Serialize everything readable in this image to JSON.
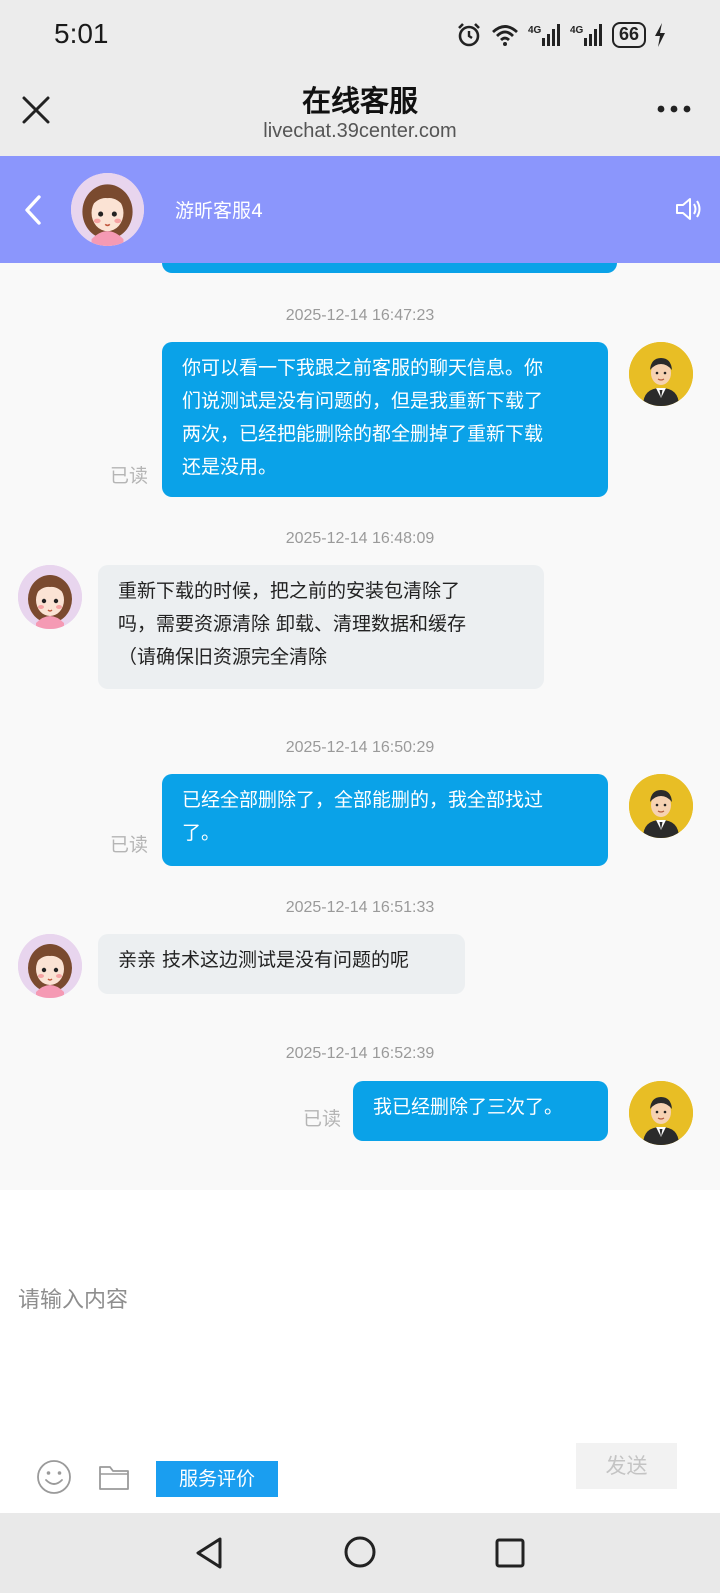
{
  "status_bar": {
    "time": "5:01",
    "battery": "66",
    "icons": [
      "alarm-icon",
      "wifi-icon",
      "signal-4g-icon",
      "signal-4g-icon",
      "charging-icon"
    ]
  },
  "browser": {
    "title": "在线客服",
    "url": "livechat.39center.com"
  },
  "chat_header": {
    "agent_name": "游昕客服4",
    "colors": {
      "header_bg": "#8b96fc"
    }
  },
  "messages": {
    "read_label": "已读",
    "items": [
      {
        "timestamp": "2025-12-14 16:47:23",
        "side": "sent",
        "lines": [
          "你可以看一下我跟之前客服的聊天信息。你",
          "们说测试是没有问题的，但是我重新下载了",
          "两次，已经把能删除的都全删掉了重新下载",
          "还是没用。"
        ],
        "read": true
      },
      {
        "timestamp": "2025-12-14 16:48:09",
        "side": "received",
        "lines": [
          "重新下载的时候，把之前的安装包清除了",
          "吗，需要资源清除 卸载、清理数据和缓存",
          "（请确保旧资源完全清除"
        ]
      },
      {
        "timestamp": "2025-12-14 16:50:29",
        "side": "sent",
        "lines": [
          "已经全部删除了，全部能删的，我全部找过",
          "了。"
        ],
        "read": true
      },
      {
        "timestamp": "2025-12-14 16:51:33",
        "side": "received",
        "lines": [
          "亲亲 技术这边测试是没有问题的呢"
        ]
      },
      {
        "timestamp": "2025-12-14 16:52:39",
        "side": "sent",
        "lines": [
          "我已经删除了三次了。"
        ],
        "read": true
      }
    ],
    "colors": {
      "sent_bubble": "#0aa2e8",
      "received_bubble": "#eceff1"
    }
  },
  "composer": {
    "placeholder": "请输入内容",
    "rate_label": "服务评价",
    "send_label": "发送"
  }
}
